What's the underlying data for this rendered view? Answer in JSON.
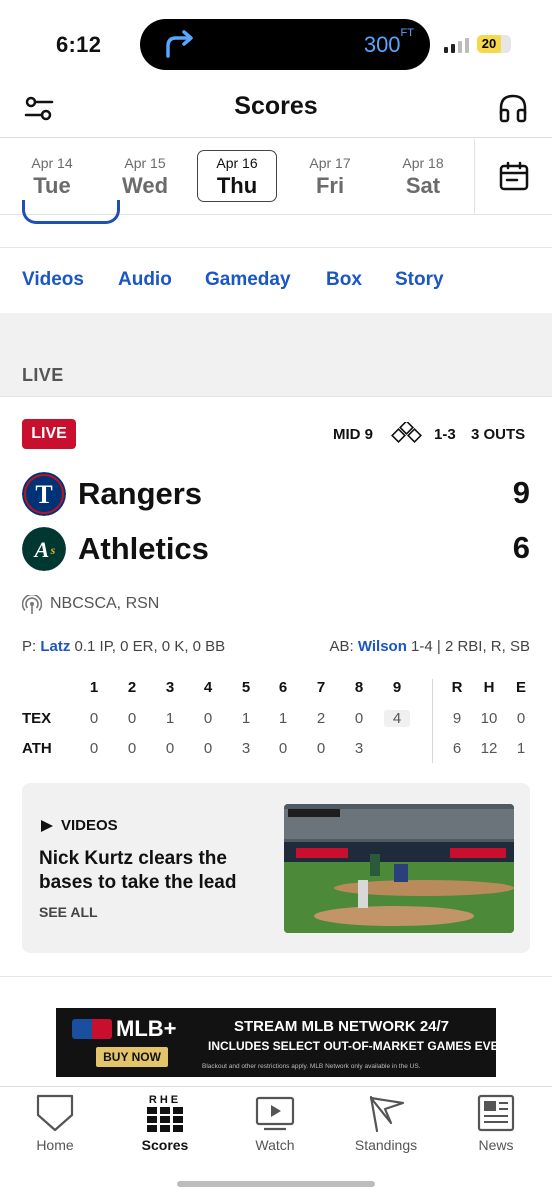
{
  "status": {
    "time": "6:12",
    "distance": "300",
    "distance_unit": "FT",
    "battery": "20"
  },
  "header": {
    "title": "Scores"
  },
  "dates": [
    {
      "dow": "Tue",
      "md": "Apr 14"
    },
    {
      "dow": "Wed",
      "md": "Apr 15"
    },
    {
      "dow": "Thu",
      "md": "Apr 16",
      "selected": true
    },
    {
      "dow": "Fri",
      "md": "Apr 17"
    },
    {
      "dow": "Sat",
      "md": "Apr 18"
    }
  ],
  "links": [
    "Videos",
    "Audio",
    "Gameday",
    "Box",
    "Story"
  ],
  "section": {
    "title": "LIVE"
  },
  "game": {
    "badge": "LIVE",
    "inning": "MID 9",
    "count": "1-3",
    "outs": "3 OUTS",
    "away": {
      "name": "Rangers",
      "score": "9",
      "logo_color": "#003278"
    },
    "home": {
      "name": "Athletics",
      "score": "6",
      "logo_color": "#003831"
    },
    "network": "NBCSCA, RSN",
    "pitcher": {
      "prefix": "P:",
      "name": "Latz",
      "line": "0.1 IP, 0 ER, 0 K, 0 BB"
    },
    "batter": {
      "prefix": "AB:",
      "name": "Wilson",
      "line": "1-4 | 2 RBI, R, SB"
    }
  },
  "linescore": {
    "innings": [
      "1",
      "2",
      "3",
      "4",
      "5",
      "6",
      "7",
      "8",
      "9"
    ],
    "totals_headers": [
      "R",
      "H",
      "E"
    ],
    "rows": [
      {
        "team": "TEX",
        "innings": [
          "0",
          "0",
          "1",
          "0",
          "1",
          "1",
          "2",
          "0",
          "4"
        ],
        "totals": [
          "9",
          "10",
          "0"
        ]
      },
      {
        "team": "ATH",
        "innings": [
          "0",
          "0",
          "0",
          "0",
          "3",
          "0",
          "0",
          "3",
          ""
        ],
        "totals": [
          "6",
          "12",
          "1"
        ]
      }
    ]
  },
  "video": {
    "label": "VIDEOS",
    "title": "Nick Kurtz clears the bases to take the lead",
    "see_all": "SEE ALL"
  },
  "ad": {
    "brand": "MLB+",
    "cta": "BUY NOW",
    "line1": "STREAM MLB NETWORK 24/7",
    "line2": "INCLUDES SELECT OUT-OF-MARKET GAMES EVERY WEEK",
    "line3": "Blackout and other restrictions apply. MLB Network only available in the US."
  },
  "tabs": {
    "home": "Home",
    "scores": "Scores",
    "scores_icon_text": "RHE",
    "watch": "Watch",
    "standings": "Standings",
    "news": "News"
  },
  "colors": {
    "accent": "#1a56c4",
    "live": "#c8102e"
  }
}
